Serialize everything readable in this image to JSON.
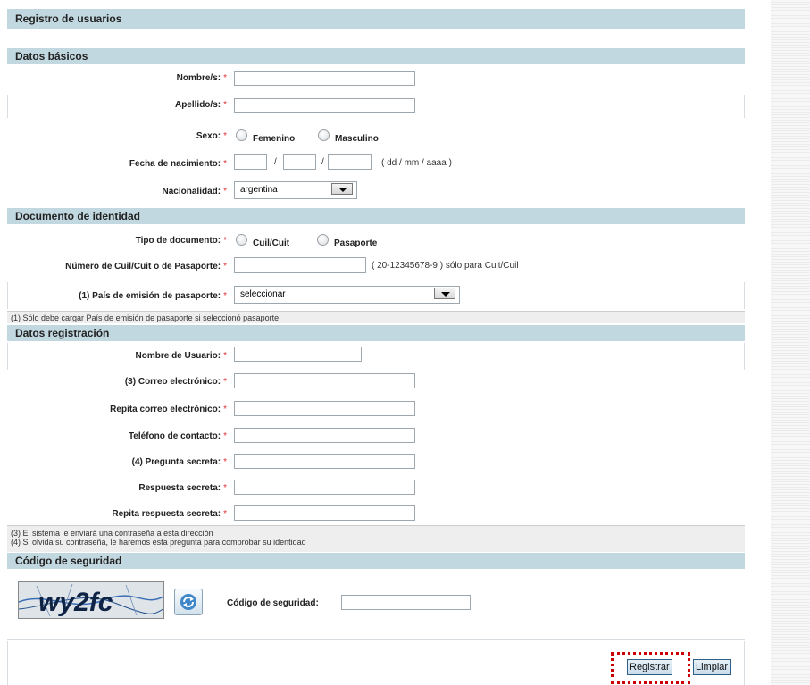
{
  "header": {
    "title": "Registro de usuarios"
  },
  "sections": {
    "basic": "Datos básicos",
    "identity": "Documento de identidad",
    "registration": "Datos registración",
    "security": "Código de seguridad"
  },
  "basic": {
    "name_label": "Nombre/s:",
    "surname_label": "Apellido/s:",
    "sex_label": "Sexo:",
    "sex_options": [
      "Femenino",
      "Masculino"
    ],
    "birth_label": "Fecha de nacimiento:",
    "date_sep": "/",
    "date_hint": "( dd / mm / aaaa )",
    "nationality_label": "Nacionalidad:",
    "nationality_value": "argentina"
  },
  "identity": {
    "doc_type_label": "Tipo de documento:",
    "doc_type_options": [
      "Cuil/Cuit",
      "Pasaporte"
    ],
    "doc_number_label": "Número de Cuil/Cuit o de Pasaporte:",
    "doc_number_hint": "( 20-12345678-9 ) sólo para Cuit/Cuil",
    "passport_country_label": "(1) País de emisión de pasaporte:",
    "passport_country_value": "seleccionar",
    "note": "(1) Sólo debe cargar País de emisión de pasaporte si seleccionó pasaporte"
  },
  "registration": {
    "username_label": "Nombre de Usuario:",
    "email_label": "(3) Correo electrónico:",
    "email_repeat_label": "Repita correo electrónico:",
    "phone_label": "Teléfono de contacto:",
    "question_label": "(4) Pregunta secreta:",
    "answer_label": "Respuesta secreta:",
    "answer_repeat_label": "Repita respuesta secreta:",
    "note3": "(3) El sistema le enviará una contraseña a esta dirección",
    "note4": "(4) Si olvida su contraseña, le haremos esta pregunta para comprobar su identidad"
  },
  "security": {
    "captcha_text": "wy2fc",
    "code_label": "Código de seguridad:"
  },
  "required_mark": "*",
  "actions": {
    "register": "Registrar",
    "clear": "Limpiar"
  },
  "colors": {
    "section_bar": "#c2d8e0",
    "required": "#dd3333",
    "highlight": "#cc0000"
  },
  "icons": {
    "refresh": "refresh-icon",
    "dropdown": "chevron-down-icon"
  }
}
